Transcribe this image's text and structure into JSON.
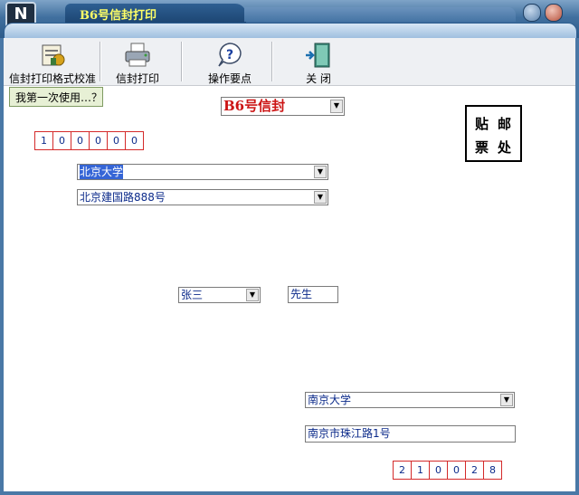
{
  "window": {
    "title": "B6号信封打印",
    "logo": "N"
  },
  "toolbar": [
    {
      "label": "信封打印格式校准",
      "icon": "calibrate-icon"
    },
    {
      "label": "信封打印",
      "icon": "printer-icon"
    },
    {
      "label": "操作要点",
      "icon": "help-icon"
    },
    {
      "label": "关  闭",
      "icon": "exit-door-icon"
    }
  ],
  "first_time_button": "我第一次使用…？",
  "envelope_type": {
    "value": "B6号信封"
  },
  "stamp": {
    "chars": [
      "贴",
      "邮",
      "票",
      "处"
    ]
  },
  "recipient": {
    "zip": [
      "1",
      "0",
      "0",
      "0",
      "0",
      "0"
    ],
    "org": "北京大学",
    "address": "北京建国路888号",
    "name": "张三",
    "title": "先生"
  },
  "sender": {
    "org": "南京大学",
    "address": "南京市珠江路1号",
    "zip": [
      "2",
      "1",
      "0",
      "0",
      "2",
      "8"
    ]
  }
}
